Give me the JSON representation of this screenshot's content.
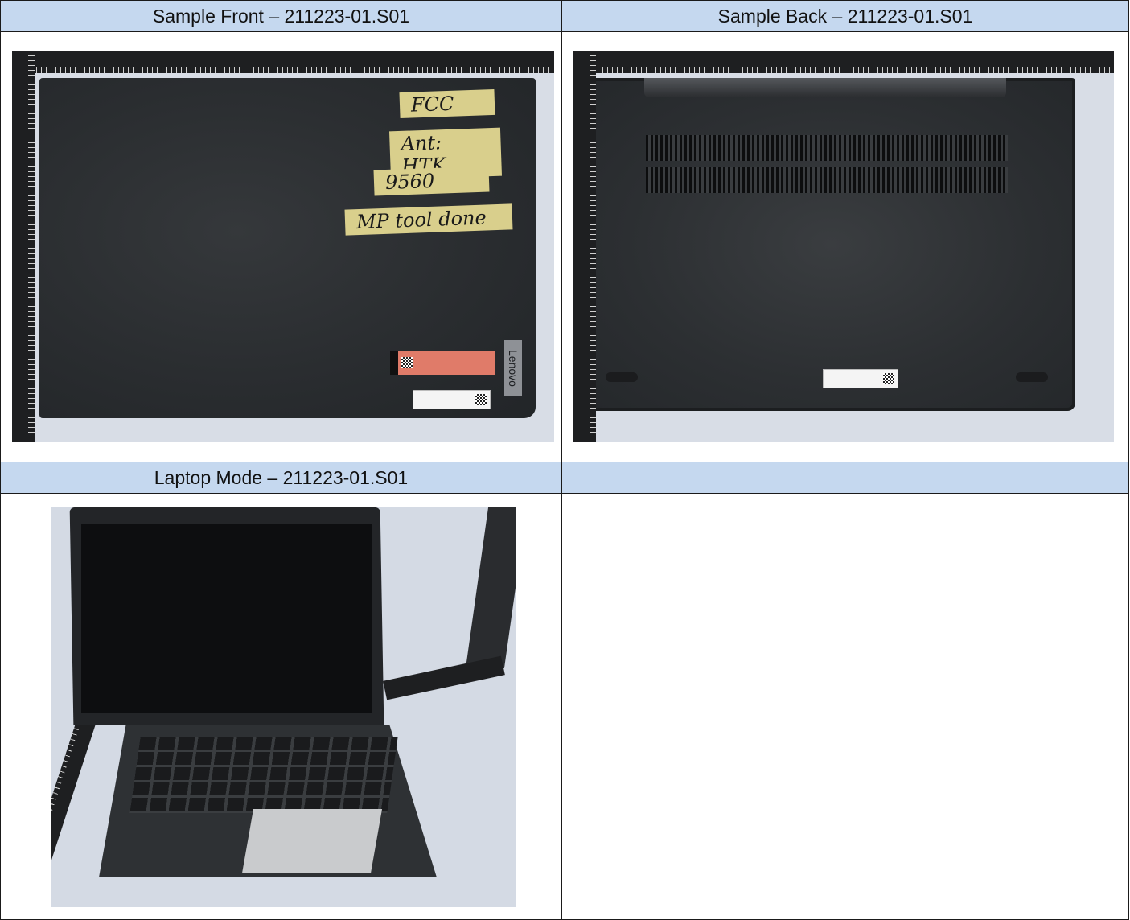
{
  "table": {
    "headers": {
      "front": "Sample Front – 211223-01.S01",
      "back": "Sample Back – 211223-01.S01",
      "laptop": "Laptop Mode – 211223-01.S01",
      "empty": ""
    }
  },
  "front_photo": {
    "tape_labels": [
      "FCC",
      "Ant: HTK",
      "9560",
      "MP tool done"
    ],
    "brand": "Lenovo"
  }
}
